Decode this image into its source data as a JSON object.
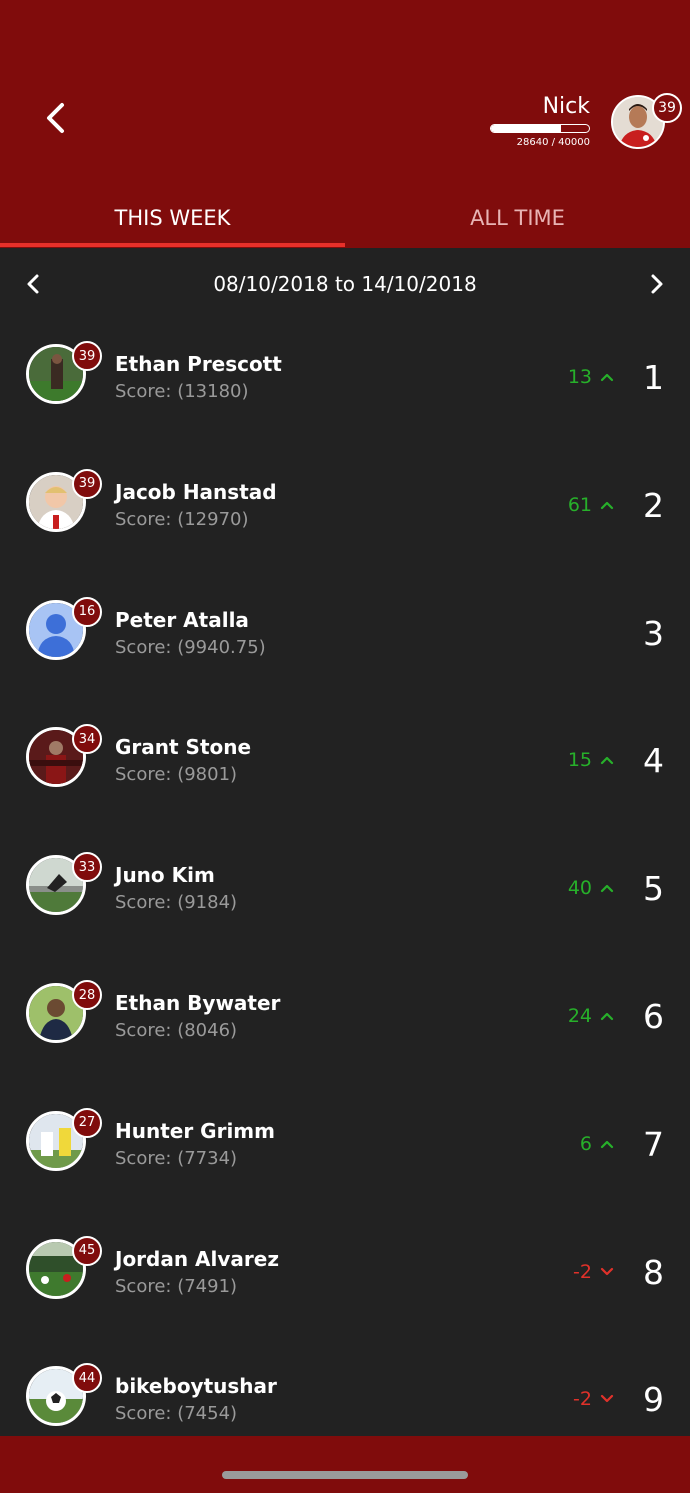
{
  "header": {
    "user_name": "Nick",
    "xp_text": "28640 / 40000",
    "xp_progress": 0.716,
    "level": "39"
  },
  "tabs": {
    "this_week": "THIS WEEK",
    "all_time": "ALL TIME"
  },
  "date_range": "08/10/2018 to 14/10/2018",
  "leaderboard": [
    {
      "name": "Ethan Prescott",
      "score": "Score: (13180)",
      "level": "39",
      "change": "13",
      "direction": "up",
      "rank": "1"
    },
    {
      "name": "Jacob Hanstad",
      "score": "Score: (12970)",
      "level": "39",
      "change": "61",
      "direction": "up",
      "rank": "2"
    },
    {
      "name": "Peter Atalla",
      "score": "Score: (9940.75)",
      "level": "16",
      "change": "",
      "direction": "none",
      "rank": "3"
    },
    {
      "name": "Grant Stone",
      "score": "Score: (9801)",
      "level": "34",
      "change": "15",
      "direction": "up",
      "rank": "4"
    },
    {
      "name": "Juno Kim",
      "score": "Score: (9184)",
      "level": "33",
      "change": "40",
      "direction": "up",
      "rank": "5"
    },
    {
      "name": "Ethan Bywater",
      "score": "Score: (8046)",
      "level": "28",
      "change": "24",
      "direction": "up",
      "rank": "6"
    },
    {
      "name": "Hunter Grimm",
      "score": "Score: (7734)",
      "level": "27",
      "change": "6",
      "direction": "up",
      "rank": "7"
    },
    {
      "name": "Jordan Alvarez",
      "score": "Score: (7491)",
      "level": "45",
      "change": "-2",
      "direction": "down",
      "rank": "8"
    },
    {
      "name": "bikeboytushar",
      "score": "Score: (7454)",
      "level": "44",
      "change": "-2",
      "direction": "down",
      "rank": "9"
    }
  ],
  "colors": {
    "primary": "#800c0c",
    "background": "#222222",
    "up": "#27b02a",
    "down": "#e0312a",
    "tab_indicator": "#e8302a"
  }
}
